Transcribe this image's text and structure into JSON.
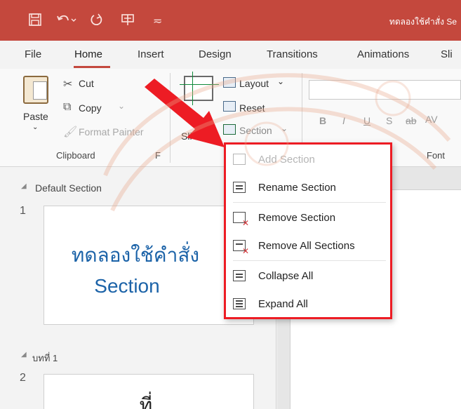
{
  "titlebar": {
    "doc_title": "ทดลองใช้คำสั่ง Se",
    "icons": [
      "save-icon",
      "undo-icon",
      "redo-icon",
      "presenter-icon",
      "customize-qat-icon"
    ]
  },
  "tabs": [
    {
      "label": "File"
    },
    {
      "label": "Home"
    },
    {
      "label": "Insert"
    },
    {
      "label": "Design"
    },
    {
      "label": "Transitions"
    },
    {
      "label": "Animations"
    },
    {
      "label": "Sli"
    }
  ],
  "active_tab": "Home",
  "ribbon": {
    "clipboard": {
      "paste": "Paste",
      "cut": "Cut",
      "copy": "Copy",
      "format_painter": "Format Painter",
      "group_label": "Clipboard",
      "launcher": "F"
    },
    "slides": {
      "layout": "Layout",
      "reset": "Reset",
      "section": "Section",
      "new_slide_partial": "Sli"
    },
    "font": {
      "group_label": "Font",
      "bold": "B",
      "italic": "I",
      "underline": "U",
      "strike": "S",
      "abc": "ab",
      "spacing": "AV"
    }
  },
  "slide_panel": {
    "sections": [
      {
        "name": "Default Section",
        "slide_number": "1",
        "thumb_lines": [
          "ทดลองใช้คำสั่ง",
          "Section"
        ]
      },
      {
        "name": "บทที่ 1",
        "slide_number": "2",
        "thumb_lines": [
          "ที่"
        ]
      }
    ]
  },
  "section_menu": {
    "items": [
      {
        "label": "Add Section",
        "enabled": false,
        "icon": "add-section-icon"
      },
      {
        "label": "Rename Section",
        "enabled": true,
        "icon": "rename-section-icon"
      },
      {
        "label": "Remove Section",
        "enabled": true,
        "icon": "remove-section-icon"
      },
      {
        "label": "Remove All Sections",
        "enabled": true,
        "icon": "remove-all-sections-icon"
      },
      {
        "label": "Collapse All",
        "enabled": true,
        "icon": "collapse-all-icon"
      },
      {
        "label": "Expand All",
        "enabled": true,
        "icon": "expand-all-icon"
      }
    ],
    "highlight_color": "#ed1c24"
  },
  "annotation": {
    "arrow_color": "#ed1c24"
  },
  "colors": {
    "titlebar": "#c4483d",
    "accent_tab": "#c4483d",
    "thumb_text": "#1c63a8"
  }
}
